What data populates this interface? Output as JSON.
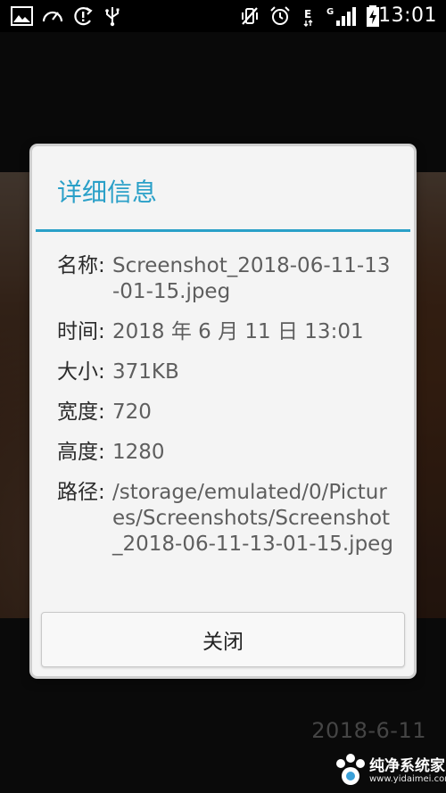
{
  "status_bar": {
    "time": "13:01",
    "left_icons": [
      "image-icon",
      "speedometer-icon",
      "sync-alert-icon",
      "usb-icon"
    ],
    "right_icons": [
      "vibrate-off-icon",
      "alarm-icon",
      "data-e-icon",
      "signal-g-icon",
      "battery-charging-icon"
    ]
  },
  "photo": {
    "date_overlay": "2018-6-11"
  },
  "dialog": {
    "title": "详细信息",
    "accent_color": "#2aa0c8",
    "details": [
      {
        "label": "名称:",
        "value": "Screenshot_2018-06-11-13-01-15.jpeg"
      },
      {
        "label": "时间:",
        "value": "2018 年 6 月 11 日 13:01"
      },
      {
        "label": "大小:",
        "value": "371KB"
      },
      {
        "label": "宽度:",
        "value": "720"
      },
      {
        "label": "高度:",
        "value": "1280"
      },
      {
        "label": "路径:",
        "value": "/storage/emulated/0/Pictures/Screenshots/Screenshot_2018-06-11-13-01-15.jpeg"
      }
    ],
    "close_label": "关闭"
  },
  "watermark": {
    "brand": "纯净系统家园",
    "url": "www.yidaimei.com"
  }
}
